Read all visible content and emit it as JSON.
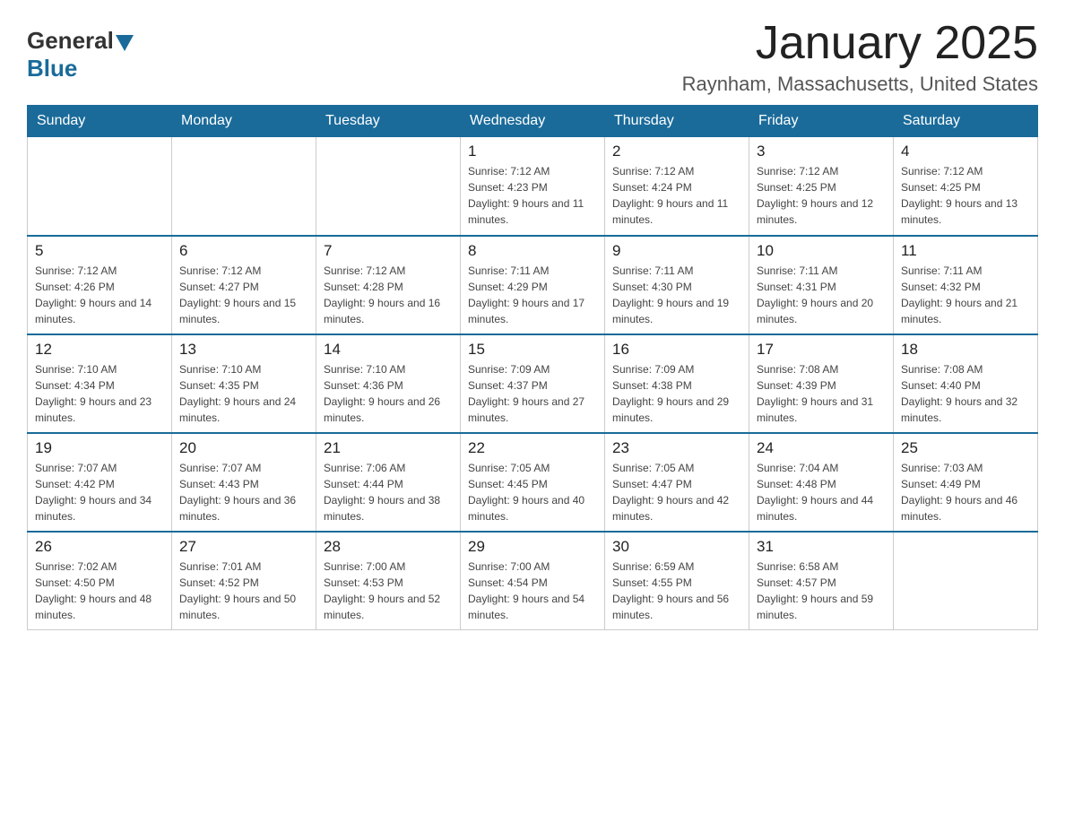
{
  "header": {
    "logo_general": "General",
    "logo_blue": "Blue",
    "month_title": "January 2025",
    "location": "Raynham, Massachusetts, United States"
  },
  "days_of_week": [
    "Sunday",
    "Monday",
    "Tuesday",
    "Wednesday",
    "Thursday",
    "Friday",
    "Saturday"
  ],
  "weeks": [
    [
      {
        "day": "",
        "sunrise": "",
        "sunset": "",
        "daylight": ""
      },
      {
        "day": "",
        "sunrise": "",
        "sunset": "",
        "daylight": ""
      },
      {
        "day": "",
        "sunrise": "",
        "sunset": "",
        "daylight": ""
      },
      {
        "day": "1",
        "sunrise": "Sunrise: 7:12 AM",
        "sunset": "Sunset: 4:23 PM",
        "daylight": "Daylight: 9 hours and 11 minutes."
      },
      {
        "day": "2",
        "sunrise": "Sunrise: 7:12 AM",
        "sunset": "Sunset: 4:24 PM",
        "daylight": "Daylight: 9 hours and 11 minutes."
      },
      {
        "day": "3",
        "sunrise": "Sunrise: 7:12 AM",
        "sunset": "Sunset: 4:25 PM",
        "daylight": "Daylight: 9 hours and 12 minutes."
      },
      {
        "day": "4",
        "sunrise": "Sunrise: 7:12 AM",
        "sunset": "Sunset: 4:25 PM",
        "daylight": "Daylight: 9 hours and 13 minutes."
      }
    ],
    [
      {
        "day": "5",
        "sunrise": "Sunrise: 7:12 AM",
        "sunset": "Sunset: 4:26 PM",
        "daylight": "Daylight: 9 hours and 14 minutes."
      },
      {
        "day": "6",
        "sunrise": "Sunrise: 7:12 AM",
        "sunset": "Sunset: 4:27 PM",
        "daylight": "Daylight: 9 hours and 15 minutes."
      },
      {
        "day": "7",
        "sunrise": "Sunrise: 7:12 AM",
        "sunset": "Sunset: 4:28 PM",
        "daylight": "Daylight: 9 hours and 16 minutes."
      },
      {
        "day": "8",
        "sunrise": "Sunrise: 7:11 AM",
        "sunset": "Sunset: 4:29 PM",
        "daylight": "Daylight: 9 hours and 17 minutes."
      },
      {
        "day": "9",
        "sunrise": "Sunrise: 7:11 AM",
        "sunset": "Sunset: 4:30 PM",
        "daylight": "Daylight: 9 hours and 19 minutes."
      },
      {
        "day": "10",
        "sunrise": "Sunrise: 7:11 AM",
        "sunset": "Sunset: 4:31 PM",
        "daylight": "Daylight: 9 hours and 20 minutes."
      },
      {
        "day": "11",
        "sunrise": "Sunrise: 7:11 AM",
        "sunset": "Sunset: 4:32 PM",
        "daylight": "Daylight: 9 hours and 21 minutes."
      }
    ],
    [
      {
        "day": "12",
        "sunrise": "Sunrise: 7:10 AM",
        "sunset": "Sunset: 4:34 PM",
        "daylight": "Daylight: 9 hours and 23 minutes."
      },
      {
        "day": "13",
        "sunrise": "Sunrise: 7:10 AM",
        "sunset": "Sunset: 4:35 PM",
        "daylight": "Daylight: 9 hours and 24 minutes."
      },
      {
        "day": "14",
        "sunrise": "Sunrise: 7:10 AM",
        "sunset": "Sunset: 4:36 PM",
        "daylight": "Daylight: 9 hours and 26 minutes."
      },
      {
        "day": "15",
        "sunrise": "Sunrise: 7:09 AM",
        "sunset": "Sunset: 4:37 PM",
        "daylight": "Daylight: 9 hours and 27 minutes."
      },
      {
        "day": "16",
        "sunrise": "Sunrise: 7:09 AM",
        "sunset": "Sunset: 4:38 PM",
        "daylight": "Daylight: 9 hours and 29 minutes."
      },
      {
        "day": "17",
        "sunrise": "Sunrise: 7:08 AM",
        "sunset": "Sunset: 4:39 PM",
        "daylight": "Daylight: 9 hours and 31 minutes."
      },
      {
        "day": "18",
        "sunrise": "Sunrise: 7:08 AM",
        "sunset": "Sunset: 4:40 PM",
        "daylight": "Daylight: 9 hours and 32 minutes."
      }
    ],
    [
      {
        "day": "19",
        "sunrise": "Sunrise: 7:07 AM",
        "sunset": "Sunset: 4:42 PM",
        "daylight": "Daylight: 9 hours and 34 minutes."
      },
      {
        "day": "20",
        "sunrise": "Sunrise: 7:07 AM",
        "sunset": "Sunset: 4:43 PM",
        "daylight": "Daylight: 9 hours and 36 minutes."
      },
      {
        "day": "21",
        "sunrise": "Sunrise: 7:06 AM",
        "sunset": "Sunset: 4:44 PM",
        "daylight": "Daylight: 9 hours and 38 minutes."
      },
      {
        "day": "22",
        "sunrise": "Sunrise: 7:05 AM",
        "sunset": "Sunset: 4:45 PM",
        "daylight": "Daylight: 9 hours and 40 minutes."
      },
      {
        "day": "23",
        "sunrise": "Sunrise: 7:05 AM",
        "sunset": "Sunset: 4:47 PM",
        "daylight": "Daylight: 9 hours and 42 minutes."
      },
      {
        "day": "24",
        "sunrise": "Sunrise: 7:04 AM",
        "sunset": "Sunset: 4:48 PM",
        "daylight": "Daylight: 9 hours and 44 minutes."
      },
      {
        "day": "25",
        "sunrise": "Sunrise: 7:03 AM",
        "sunset": "Sunset: 4:49 PM",
        "daylight": "Daylight: 9 hours and 46 minutes."
      }
    ],
    [
      {
        "day": "26",
        "sunrise": "Sunrise: 7:02 AM",
        "sunset": "Sunset: 4:50 PM",
        "daylight": "Daylight: 9 hours and 48 minutes."
      },
      {
        "day": "27",
        "sunrise": "Sunrise: 7:01 AM",
        "sunset": "Sunset: 4:52 PM",
        "daylight": "Daylight: 9 hours and 50 minutes."
      },
      {
        "day": "28",
        "sunrise": "Sunrise: 7:00 AM",
        "sunset": "Sunset: 4:53 PM",
        "daylight": "Daylight: 9 hours and 52 minutes."
      },
      {
        "day": "29",
        "sunrise": "Sunrise: 7:00 AM",
        "sunset": "Sunset: 4:54 PM",
        "daylight": "Daylight: 9 hours and 54 minutes."
      },
      {
        "day": "30",
        "sunrise": "Sunrise: 6:59 AM",
        "sunset": "Sunset: 4:55 PM",
        "daylight": "Daylight: 9 hours and 56 minutes."
      },
      {
        "day": "31",
        "sunrise": "Sunrise: 6:58 AM",
        "sunset": "Sunset: 4:57 PM",
        "daylight": "Daylight: 9 hours and 59 minutes."
      },
      {
        "day": "",
        "sunrise": "",
        "sunset": "",
        "daylight": ""
      }
    ]
  ]
}
